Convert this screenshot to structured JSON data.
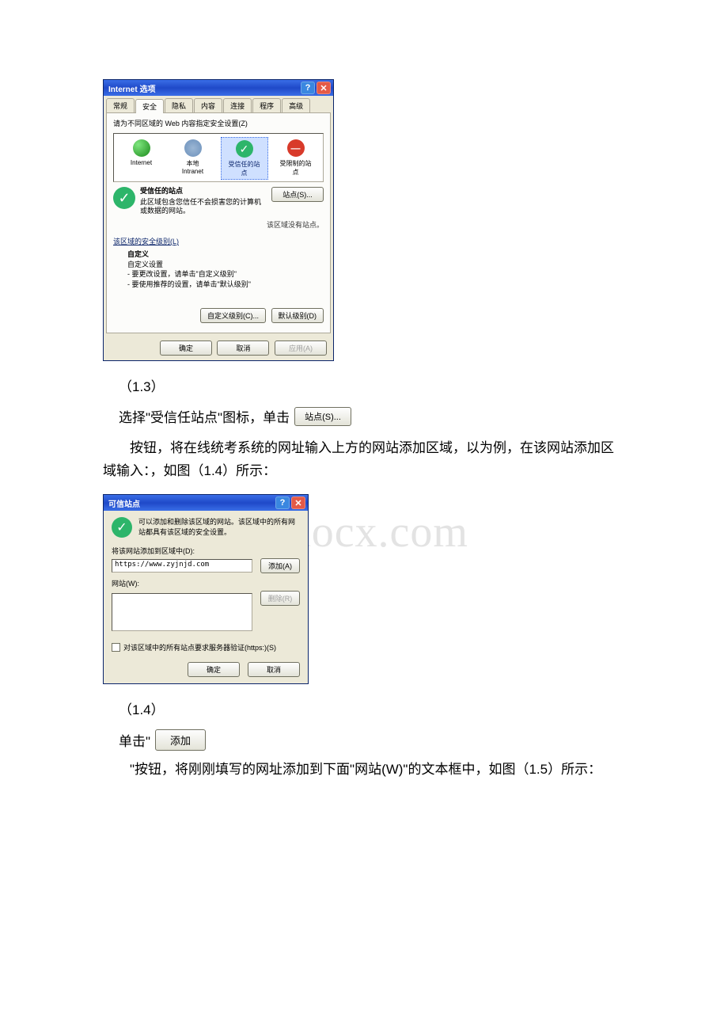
{
  "watermark": "www.bdocx.com",
  "dialog1": {
    "title": "Internet 选项",
    "tabs": [
      "常规",
      "安全",
      "隐私",
      "内容",
      "连接",
      "程序",
      "高级"
    ],
    "activeTab": "安全",
    "zonePrompt": "请为不同区域的 Web 内容指定安全设置(Z)",
    "zones": {
      "internet": "Internet",
      "local": "本地\nIntranet",
      "trusted": "受信任的站\n点",
      "restricted": "受限制的站\n点"
    },
    "zoneTitle": "受信任的站点",
    "zoneDesc": "此区域包含您信任不会损害您的计算机或数据的网站。",
    "sitesBtn": "站点(S)...",
    "sitesStatus": "该区域没有站点。",
    "levelGroup": "该区域的安全级别(L)",
    "customTitle": "自定义",
    "customLine1": "自定义设置",
    "customLine2": "- 要更改设置，请单击\"自定义级别\"",
    "customLine3": "- 要使用推荐的设置，请单击\"默认级别\"",
    "btnCustomLevel": "自定义级别(C)...",
    "btnDefaultLevel": "默认级别(D)",
    "btnOK": "确定",
    "btnCancel": "取消",
    "btnApply": "应用(A)"
  },
  "caption1": "（1.3）",
  "para1_pre": "选择\"受信任站点\"图标，单击",
  "sitesBtnInline": "站点(S)...",
  "para2": "按钮，将在线统考系统的网址输入上方的网站添加区域，以为例，在该网站添加区域输入：，如图（1.4）所示：",
  "dialog2": {
    "title": "可信站点",
    "desc": "可以添加和删除该区域的网站。该区域中的所有网站都具有该区域的安全设置。",
    "addLabel": "将该网站添加到区域中(D):",
    "inputValue": "https://www.zyjnjd.com",
    "addBtn": "添加(A)",
    "listLabel": "网站(W):",
    "removeBtn": "删除(R)",
    "checkLabel": "对该区域中的所有站点要求服务器验证(https:)(S)",
    "btnOK": "确定",
    "btnCancel": "取消"
  },
  "caption2": "（1.4）",
  "para3_pre": "单击\"",
  "addBtnInline": "添加",
  "para4": "\"按钮，将刚刚填写的网址添加到下面\"网站(W)\"的文本框中，如图（1.5）所示："
}
